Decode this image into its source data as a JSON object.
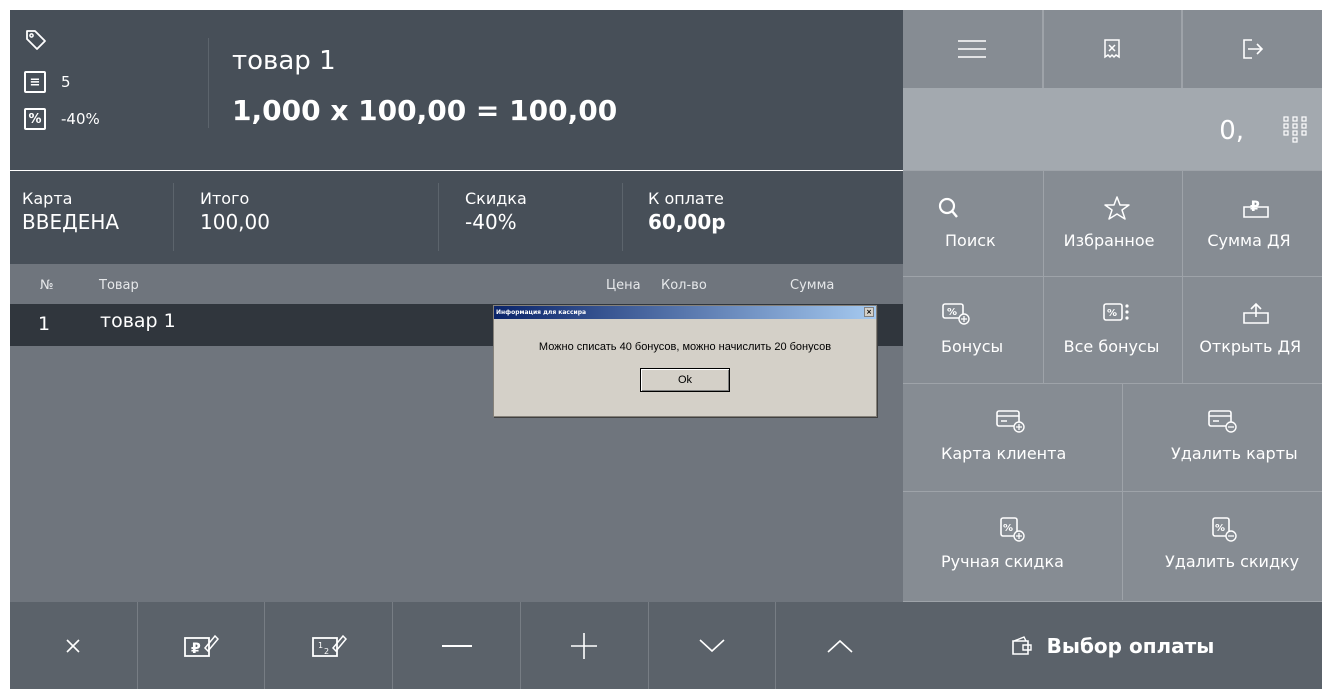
{
  "product": {
    "name": "товар 1",
    "calc": "1,000 x 100,00 = 100,00",
    "qty_count": "5",
    "discount": "-40%",
    "list_icon_label": "≡",
    "percent_icon_label": "%"
  },
  "totals": {
    "card_label": "Карта",
    "card_value": "ВВЕДЕНА",
    "total_label": "Итого",
    "total_value": "100,00",
    "discount_label": "Скидка",
    "discount_value": "-40%",
    "pay_label": "К оплате",
    "pay_value": "60,00р"
  },
  "table": {
    "headers": {
      "num": "№",
      "item": "Товар",
      "price": "Цена",
      "qty": "Кол-во",
      "sum": "Сумма"
    },
    "rows": [
      {
        "num": "1",
        "name": "товар 1"
      }
    ]
  },
  "numfield": {
    "value": "0,"
  },
  "actions": {
    "search": "Поиск",
    "favorites": "Избранное",
    "sum_dya": "Сумма ДЯ",
    "bonuses": "Бонусы",
    "all_bonuses": "Все бонусы",
    "open_dya": "Открыть ДЯ",
    "client_card": "Карта клиента",
    "delete_cards": "Удалить карты",
    "manual_discount": "Ручная скидка",
    "delete_discount": "Удалить скидку",
    "payment_choice": "Выбор оплаты"
  },
  "dialog": {
    "title": "Информация для кассира",
    "message": "Можно списать 40 бонусов, можно начислить 20 бонусов",
    "ok": "Ok",
    "close": "×"
  }
}
